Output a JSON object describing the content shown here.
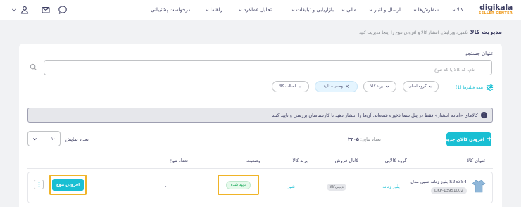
{
  "header": {
    "logo_main": "digikala",
    "logo_sub": "SELLER CENTER",
    "nav": [
      {
        "label": "کالا"
      },
      {
        "label": "سفارش‌ها"
      },
      {
        "label": "ارسال و انبار"
      },
      {
        "label": "مالی"
      },
      {
        "label": "بازاریابی و تبلیغات"
      },
      {
        "label": "تحلیل عملکرد"
      },
      {
        "label": "راهنما"
      },
      {
        "label": "درخواست پشتیبانی"
      }
    ]
  },
  "page": {
    "title": "مدیریت کالا",
    "subtitle": "تکمیل، ویرایش، انتشار کالا و افزودن تنوع را اینجا مدیریت کنید"
  },
  "search": {
    "label": "عنوان جستجو",
    "placeholder": "نام، کد کالا یا کد تنوع"
  },
  "filters": {
    "all_label": "همه فیلترها (1)",
    "chips": [
      {
        "label": "گروه اصلی"
      },
      {
        "label": "برند کالا"
      },
      {
        "label": "وضعیت تایید"
      },
      {
        "label": "اصالت کالا"
      }
    ]
  },
  "alert": {
    "text": "کالاهای «آماده انتشار» فقط در پنل شما ذخیره شده‌اند. آن‌ها را انتشار دهید تا کارشناسان بررسی و تایید کنند"
  },
  "toolbar": {
    "add_product_label": "افزودن کالای جدید",
    "result_label": "تعداد نتایج:",
    "result_count": "۳۴۰۵",
    "show_count_label": "تعداد نمایش",
    "page_size": "۱۰"
  },
  "table": {
    "headers": {
      "title": "عنوان کالا",
      "group": "گروه کالایی",
      "channel": "کانال فروش",
      "brand": "برند کالا",
      "status": "وضعیت",
      "variant_count": "تعداد تنوع"
    },
    "rows": [
      {
        "title": "بلوز زنانه شین مدل S25354",
        "dkp": "DKP-13951002",
        "group": "بلوز زنانه",
        "channel": "دیجی‌کالا",
        "brand": "شین",
        "status": "تایید شده",
        "variant_count": "-",
        "add_variant_label": "افزودن تنوع"
      }
    ]
  },
  "colors": {
    "accent": "#19bfd3",
    "highlight_border": "#f0b428",
    "approved_green": "#00a049"
  }
}
